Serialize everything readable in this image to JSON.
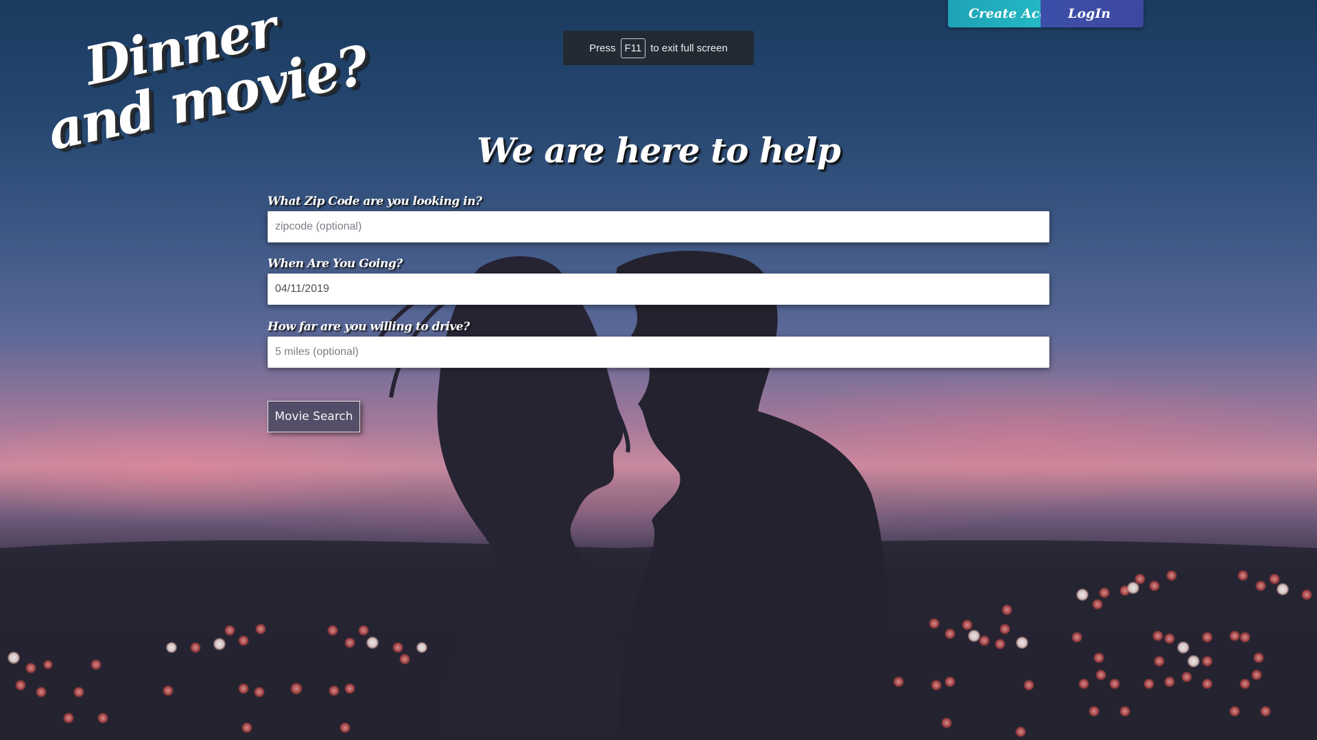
{
  "logo": {
    "line1": "Dinner",
    "line2": "and movie?"
  },
  "fullscreen_notice": {
    "prefix": "Press",
    "key": "F11",
    "suffix": "to exit full screen"
  },
  "auth": {
    "create_label": "Create Account",
    "login_label": "LogIn"
  },
  "heading": "We are here to help",
  "form": {
    "zip": {
      "label": "What Zip Code are you looking in?",
      "placeholder": "zipcode (optional)",
      "value": ""
    },
    "date": {
      "label": "When Are You Going?",
      "value": "04/11/2019"
    },
    "distance": {
      "label": "How far are you willing to drive?",
      "placeholder": "5 miles (optional)",
      "value": ""
    },
    "submit_label": "Movie Search"
  },
  "colors": {
    "create_button": "#23b7c4",
    "login_button": "#3f48a0",
    "toast_bg": "#232a34"
  }
}
